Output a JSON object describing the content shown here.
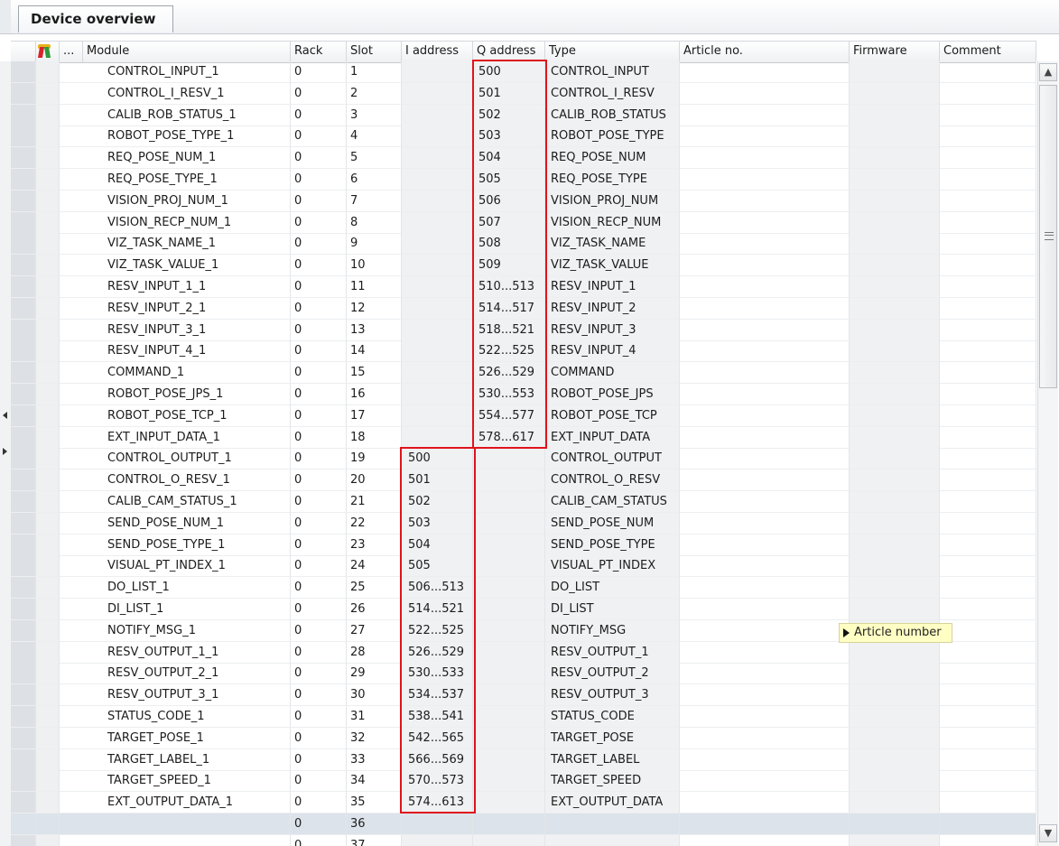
{
  "tab": {
    "label": "Device overview"
  },
  "columns": {
    "dots": "...",
    "module": "Module",
    "rack": "Rack",
    "slot": "Slot",
    "i_address": "I address",
    "q_address": "Q address",
    "type": "Type",
    "article": "Article no.",
    "firmware": "Firmware",
    "comment": "Comment"
  },
  "rows": [
    {
      "module": "CONTROL_INPUT_1",
      "rack": "0",
      "slot": "1",
      "i": "",
      "q": "500",
      "type": "CONTROL_INPUT"
    },
    {
      "module": "CONTROL_I_RESV_1",
      "rack": "0",
      "slot": "2",
      "i": "",
      "q": "501",
      "type": "CONTROL_I_RESV"
    },
    {
      "module": "CALIB_ROB_STATUS_1",
      "rack": "0",
      "slot": "3",
      "i": "",
      "q": "502",
      "type": "CALIB_ROB_STATUS"
    },
    {
      "module": "ROBOT_POSE_TYPE_1",
      "rack": "0",
      "slot": "4",
      "i": "",
      "q": "503",
      "type": "ROBOT_POSE_TYPE"
    },
    {
      "module": "REQ_POSE_NUM_1",
      "rack": "0",
      "slot": "5",
      "i": "",
      "q": "504",
      "type": "REQ_POSE_NUM"
    },
    {
      "module": "REQ_POSE_TYPE_1",
      "rack": "0",
      "slot": "6",
      "i": "",
      "q": "505",
      "type": "REQ_POSE_TYPE"
    },
    {
      "module": "VISION_PROJ_NUM_1",
      "rack": "0",
      "slot": "7",
      "i": "",
      "q": "506",
      "type": "VISION_PROJ_NUM"
    },
    {
      "module": "VISION_RECP_NUM_1",
      "rack": "0",
      "slot": "8",
      "i": "",
      "q": "507",
      "type": "VISION_RECP_NUM"
    },
    {
      "module": "VIZ_TASK_NAME_1",
      "rack": "0",
      "slot": "9",
      "i": "",
      "q": "508",
      "type": "VIZ_TASK_NAME"
    },
    {
      "module": "VIZ_TASK_VALUE_1",
      "rack": "0",
      "slot": "10",
      "i": "",
      "q": "509",
      "type": "VIZ_TASK_VALUE"
    },
    {
      "module": "RESV_INPUT_1_1",
      "rack": "0",
      "slot": "11",
      "i": "",
      "q": "510...513",
      "type": "RESV_INPUT_1"
    },
    {
      "module": "RESV_INPUT_2_1",
      "rack": "0",
      "slot": "12",
      "i": "",
      "q": "514...517",
      "type": "RESV_INPUT_2"
    },
    {
      "module": "RESV_INPUT_3_1",
      "rack": "0",
      "slot": "13",
      "i": "",
      "q": "518...521",
      "type": "RESV_INPUT_3"
    },
    {
      "module": "RESV_INPUT_4_1",
      "rack": "0",
      "slot": "14",
      "i": "",
      "q": "522...525",
      "type": "RESV_INPUT_4"
    },
    {
      "module": "COMMAND_1",
      "rack": "0",
      "slot": "15",
      "i": "",
      "q": "526...529",
      "type": "COMMAND"
    },
    {
      "module": "ROBOT_POSE_JPS_1",
      "rack": "0",
      "slot": "16",
      "i": "",
      "q": "530...553",
      "type": "ROBOT_POSE_JPS"
    },
    {
      "module": "ROBOT_POSE_TCP_1",
      "rack": "0",
      "slot": "17",
      "i": "",
      "q": "554...577",
      "type": "ROBOT_POSE_TCP"
    },
    {
      "module": "EXT_INPUT_DATA_1",
      "rack": "0",
      "slot": "18",
      "i": "",
      "q": "578...617",
      "type": "EXT_INPUT_DATA"
    },
    {
      "module": "CONTROL_OUTPUT_1",
      "rack": "0",
      "slot": "19",
      "i": "500",
      "q": "",
      "type": "CONTROL_OUTPUT"
    },
    {
      "module": "CONTROL_O_RESV_1",
      "rack": "0",
      "slot": "20",
      "i": "501",
      "q": "",
      "type": "CONTROL_O_RESV"
    },
    {
      "module": "CALIB_CAM_STATUS_1",
      "rack": "0",
      "slot": "21",
      "i": "502",
      "q": "",
      "type": "CALIB_CAM_STATUS"
    },
    {
      "module": "SEND_POSE_NUM_1",
      "rack": "0",
      "slot": "22",
      "i": "503",
      "q": "",
      "type": "SEND_POSE_NUM"
    },
    {
      "module": "SEND_POSE_TYPE_1",
      "rack": "0",
      "slot": "23",
      "i": "504",
      "q": "",
      "type": "SEND_POSE_TYPE"
    },
    {
      "module": "VISUAL_PT_INDEX_1",
      "rack": "0",
      "slot": "24",
      "i": "505",
      "q": "",
      "type": "VISUAL_PT_INDEX"
    },
    {
      "module": "DO_LIST_1",
      "rack": "0",
      "slot": "25",
      "i": "506...513",
      "q": "",
      "type": "DO_LIST"
    },
    {
      "module": "DI_LIST_1",
      "rack": "0",
      "slot": "26",
      "i": "514...521",
      "q": "",
      "type": "DI_LIST"
    },
    {
      "module": "NOTIFY_MSG_1",
      "rack": "0",
      "slot": "27",
      "i": "522...525",
      "q": "",
      "type": "NOTIFY_MSG"
    },
    {
      "module": "RESV_OUTPUT_1_1",
      "rack": "0",
      "slot": "28",
      "i": "526...529",
      "q": "",
      "type": "RESV_OUTPUT_1"
    },
    {
      "module": "RESV_OUTPUT_2_1",
      "rack": "0",
      "slot": "29",
      "i": "530...533",
      "q": "",
      "type": "RESV_OUTPUT_2"
    },
    {
      "module": "RESV_OUTPUT_3_1",
      "rack": "0",
      "slot": "30",
      "i": "534...537",
      "q": "",
      "type": "RESV_OUTPUT_3"
    },
    {
      "module": "STATUS_CODE_1",
      "rack": "0",
      "slot": "31",
      "i": "538...541",
      "q": "",
      "type": "STATUS_CODE"
    },
    {
      "module": "TARGET_POSE_1",
      "rack": "0",
      "slot": "32",
      "i": "542...565",
      "q": "",
      "type": "TARGET_POSE"
    },
    {
      "module": "TARGET_LABEL_1",
      "rack": "0",
      "slot": "33",
      "i": "566...569",
      "q": "",
      "type": "TARGET_LABEL"
    },
    {
      "module": "TARGET_SPEED_1",
      "rack": "0",
      "slot": "34",
      "i": "570...573",
      "q": "",
      "type": "TARGET_SPEED"
    },
    {
      "module": "EXT_OUTPUT_DATA_1",
      "rack": "0",
      "slot": "35",
      "i": "574...613",
      "q": "",
      "type": "EXT_OUTPUT_DATA"
    },
    {
      "module": "",
      "rack": "0",
      "slot": "36",
      "i": "",
      "q": "",
      "type": ""
    },
    {
      "module": "",
      "rack": "0",
      "slot": "37",
      "i": "",
      "q": "",
      "type": ""
    }
  ],
  "tooltip": {
    "text": "Article number"
  },
  "scrollbar": {
    "up": "▲",
    "down": "▼"
  },
  "colors": {
    "highlight": "#e0141c",
    "tooltip_bg": "#ffffc4"
  }
}
